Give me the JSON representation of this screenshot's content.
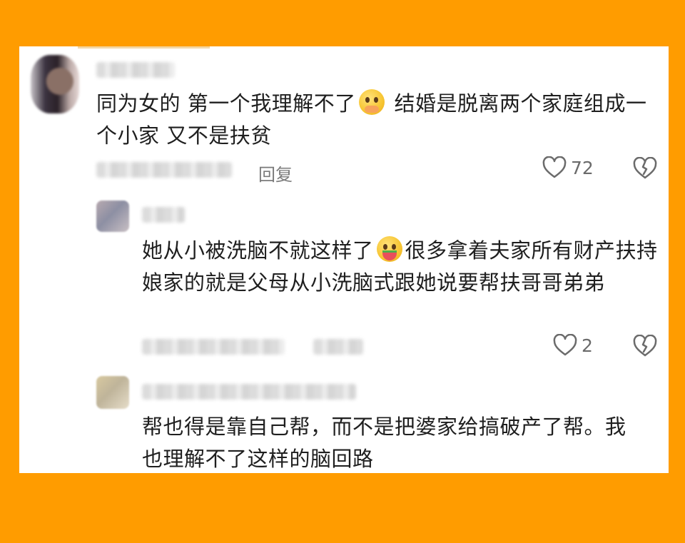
{
  "comments": [
    {
      "text_a": "同为女的 第一个我理解不了",
      "text_b": " 结婚是脱离两个家庭组成一个小家 又不是扶贫",
      "reply_label": "回复",
      "likes": "72",
      "emoji": "pleading-face-icon"
    },
    {
      "text_a": "她从小被洗脑不就这样了",
      "text_b": "很多拿着夫家所有财产扶持娘家的就是父母从小洗脑式跟她说要帮扶哥哥弟弟",
      "likes": "2",
      "emoji": "watermelon-face-icon"
    },
    {
      "text": "帮也得是靠自己帮，而不是把婆家给搞破产了帮。我也理解不了这样的脑回路"
    }
  ],
  "colors": {
    "frame": "#FF9C00",
    "card": "#ffffff",
    "text": "#1f1f1f",
    "meta": "#7a7a7a"
  }
}
